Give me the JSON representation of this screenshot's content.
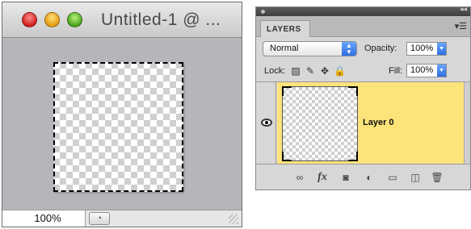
{
  "document_window": {
    "title": "Untitled-1 @ ...",
    "zoom": "100%"
  },
  "layers_panel": {
    "tab_label": "LAYERS",
    "blend_mode": "Normal",
    "opacity_label": "Opacity:",
    "opacity_value": "100%",
    "lock_label": "Lock:",
    "fill_label": "Fill:",
    "fill_value": "100%",
    "layers": [
      {
        "name": "Layer 0",
        "visible": true,
        "selected": true
      }
    ],
    "footer_icons": [
      "link-icon",
      "fx-icon",
      "mask-icon",
      "adjustment-icon",
      "folder-icon",
      "new-layer-icon",
      "trash-icon"
    ]
  },
  "colors": {
    "selected_layer": "#fde47a",
    "canvas_bg": "#b4b6ba",
    "panel_bg": "#d7d7d7"
  }
}
